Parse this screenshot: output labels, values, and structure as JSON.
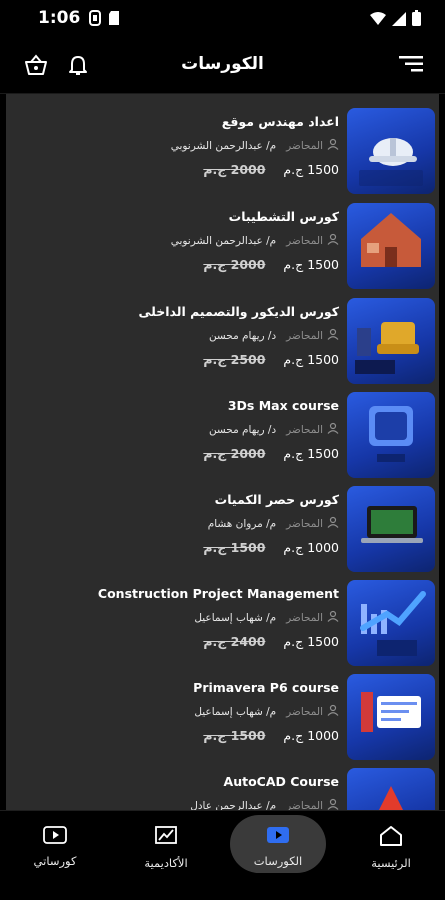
{
  "status": {
    "time": "1:06",
    "icons": [
      "android-d-icon",
      "sd-card-icon",
      "wifi-icon",
      "signal-icon",
      "battery-icon"
    ]
  },
  "app_bar": {
    "title": "الكورسات",
    "icons": [
      "menu-icon",
      "bell-icon",
      "basket-icon"
    ]
  },
  "courses": [
    {
      "title": "اعداد مهندس موقع",
      "instructor_label": "المحاضر",
      "instructor": "م/ عبدالرحمن الشرنوبي",
      "price": "1500 ج.م",
      "old_price": "2000 ج.م",
      "thumb": "helmet"
    },
    {
      "title": "كورس التشطيبات",
      "instructor_label": "المحاضر",
      "instructor": "م/ عبدالرحمن الشرنوبي",
      "price": "1500 ج.م",
      "old_price": "2000 ج.م",
      "thumb": "house"
    },
    {
      "title": "كورس الديكور والتصميم الداخلى",
      "instructor_label": "المحاضر",
      "instructor": "د/ ريهام محسن",
      "price": "1500 ج.م",
      "old_price": "2500 ج.م",
      "thumb": "sofa"
    },
    {
      "title": "3Ds Max course",
      "instructor_label": "المحاضر",
      "instructor": "د/ ريهام محسن",
      "price": "1500 ج.م",
      "old_price": "2000 ج.م",
      "thumb": "3d"
    },
    {
      "title": "كورس حصر الكميات",
      "instructor_label": "المحاضر",
      "instructor": "م/ مروان هشام",
      "price": "1000 ج.م",
      "old_price": "1500 ج.م",
      "thumb": "laptop"
    },
    {
      "title": "Construction Project Management",
      "instructor_label": "المحاضر",
      "instructor": "م/ شهاب إسماعيل",
      "price": "1500 ج.م",
      "old_price": "2400 ج.م",
      "thumb": "chart"
    },
    {
      "title": "Primavera P6 course",
      "instructor_label": "المحاضر",
      "instructor": "م/ شهاب إسماعيل",
      "price": "1000 ج.م",
      "old_price": "1500 ج.م",
      "thumb": "primavera"
    },
    {
      "title": "AutoCAD Course",
      "instructor_label": "المحاضر",
      "instructor": "م/ عبدالرحمن عادل",
      "price": "",
      "old_price": "",
      "thumb": "autocad"
    }
  ],
  "nav": {
    "items": [
      {
        "label": "الرئيسية",
        "icon": "home-icon"
      },
      {
        "label": "الكورسات",
        "icon": "play-video-icon",
        "active": true
      },
      {
        "label": "الأكاديمية",
        "icon": "chart-board-icon"
      },
      {
        "label": "كورساتي",
        "icon": "my-video-icon"
      }
    ]
  },
  "colors": {
    "background": "#000000",
    "list_background": "#2c2c2c",
    "accent": "#2f6df0",
    "muted_text": "#8f8f8f"
  }
}
